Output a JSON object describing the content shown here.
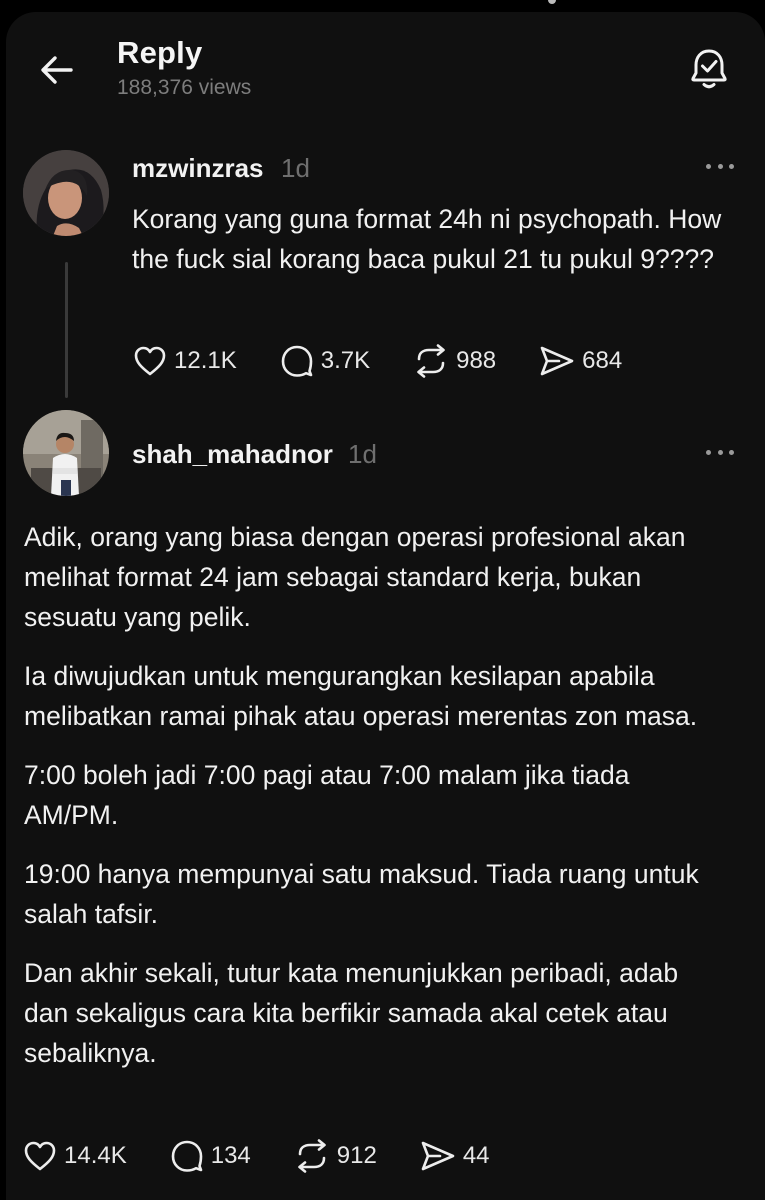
{
  "header": {
    "title": "Reply",
    "views": "188,376 views"
  },
  "icons": {
    "back": "arrow-left-icon",
    "notify": "bell-check-icon",
    "more": "more-dots-icon",
    "like": "heart-icon",
    "comment": "comment-bubble-icon",
    "repost": "repost-icon",
    "share": "send-icon"
  },
  "colors": {
    "background": "#101010",
    "text": "#f1f1f1",
    "muted": "#7d7d7d",
    "thread_line": "#3a3a3a"
  },
  "post": {
    "username": "mzwinzras",
    "time": "1d",
    "text": "Korang yang guna format 24h ni psychopath. How the fuck sial korang baca pukul 21 tu pukul 9????",
    "stats": {
      "likes": "12.1K",
      "comments": "3.7K",
      "reposts": "988",
      "shares": "684"
    }
  },
  "reply": {
    "username": "shah_mahadnor",
    "time": "1d",
    "paragraphs": [
      "Adik, orang yang biasa dengan operasi profesional akan melihat format 24 jam sebagai standard kerja, bukan sesuatu yang pelik.",
      "Ia diwujudkan untuk mengurangkan kesilapan apabila melibatkan ramai pihak atau operasi merentas zon masa.",
      "7:00 boleh jadi 7:00 pagi atau 7:00 malam jika tiada AM/PM.",
      "19:00 hanya mempunyai satu maksud. Tiada ruang untuk salah tafsir.",
      "Dan akhir sekali, tutur kata menunjukkan peribadi, adab dan sekaligus cara kita berfikir samada akal cetek atau sebaliknya."
    ],
    "stats": {
      "likes": "14.4K",
      "comments": "134",
      "reposts": "912",
      "shares": "44"
    }
  }
}
